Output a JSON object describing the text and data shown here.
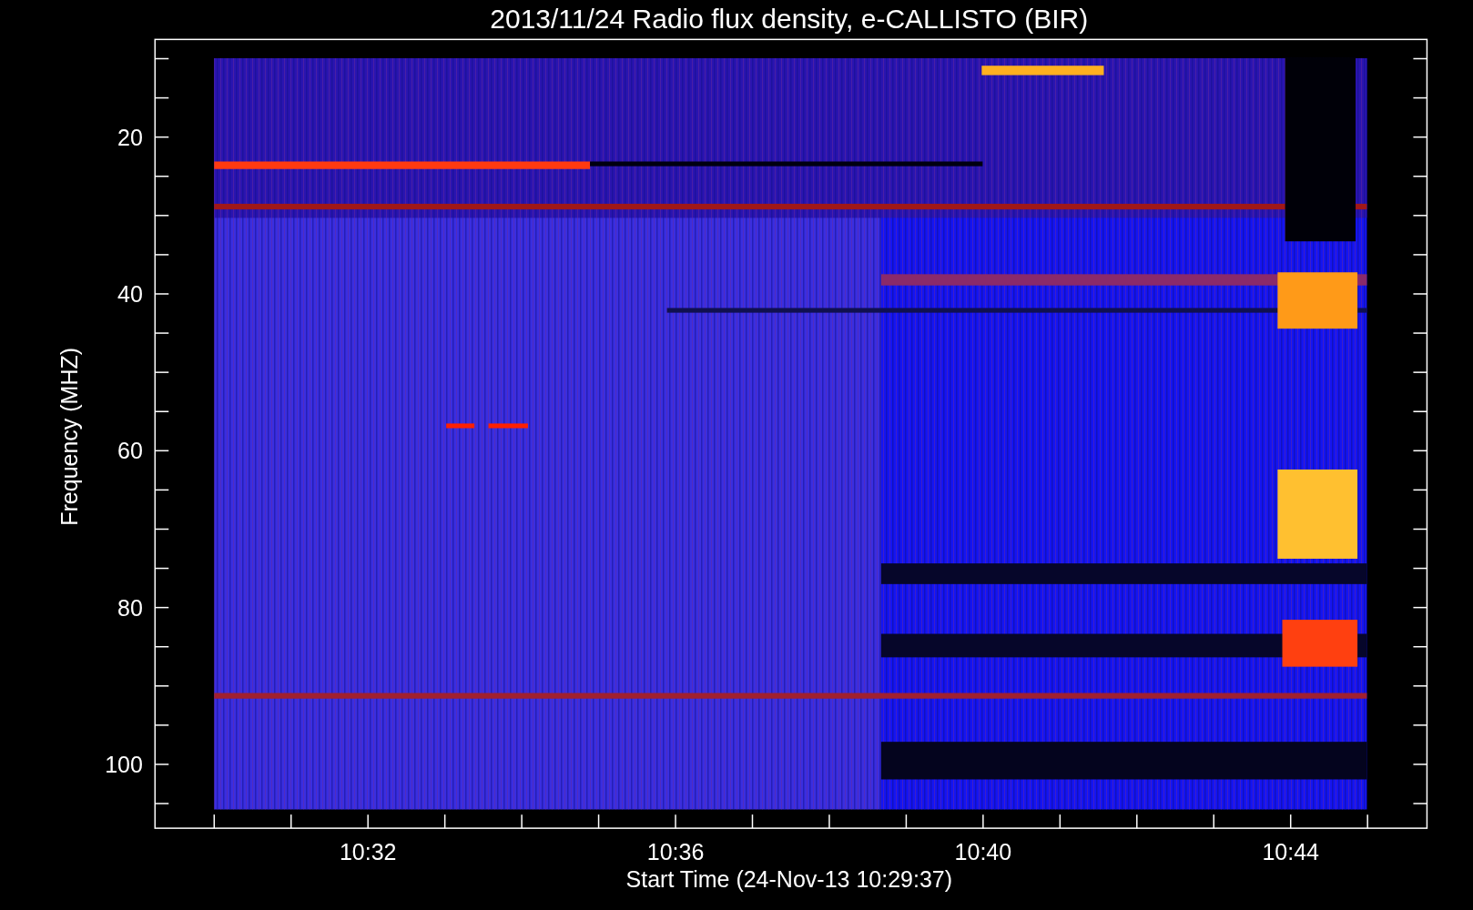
{
  "plot": {
    "title": "2013/11/24  Radio flux density, e-CALLISTO (BIR)",
    "y_axis": {
      "label": "Frequency (MHZ)",
      "ticks": [
        "20",
        "40",
        "60",
        "80",
        "100"
      ]
    },
    "x_axis": {
      "label": "Start Time (24-Nov-13 10:29:37)",
      "ticks": [
        "10:32",
        "10:36",
        "10:40",
        "10:44"
      ]
    }
  }
}
